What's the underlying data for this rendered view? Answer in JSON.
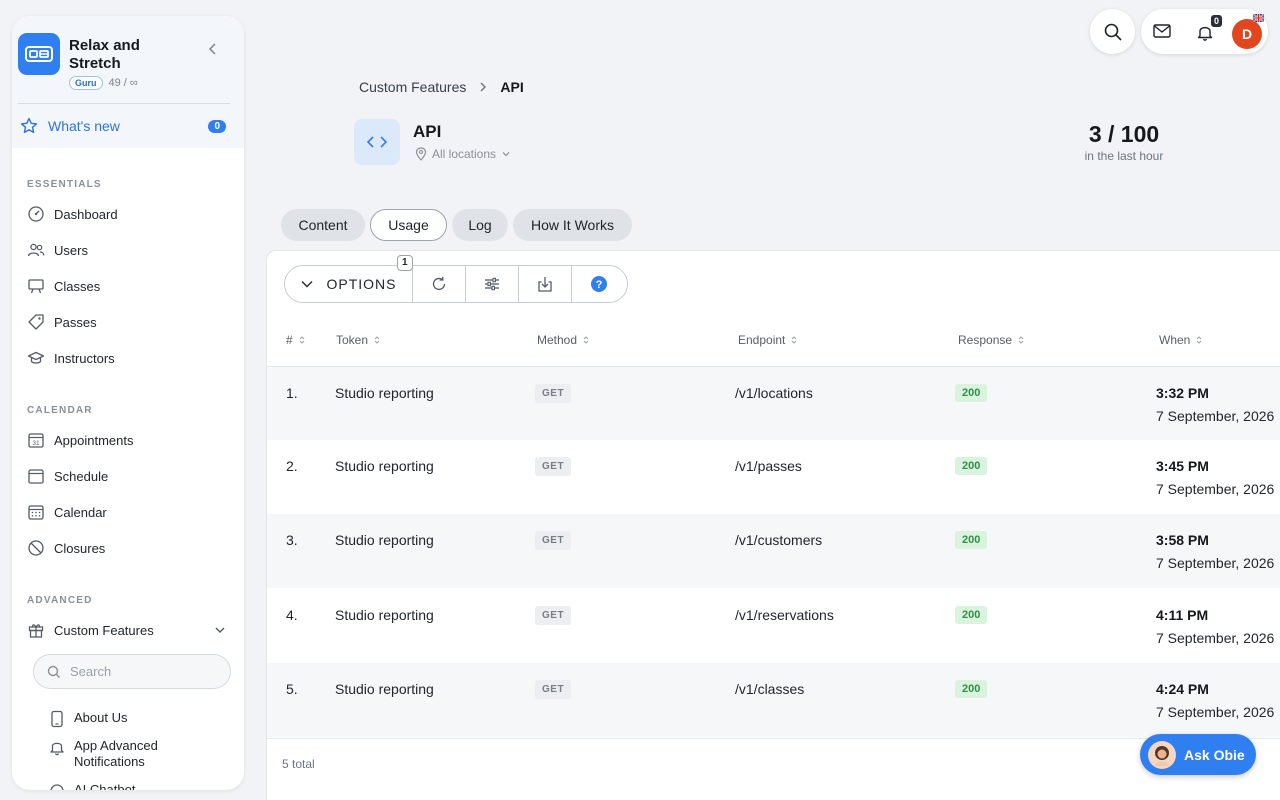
{
  "app": {
    "name": "Relax and Stretch",
    "plan_badge": "Guru",
    "usage": "49 / ∞"
  },
  "sidebar": {
    "whats_new": {
      "label": "What's new",
      "count": "0"
    },
    "sections": [
      {
        "title": "ESSENTIALS",
        "items": [
          {
            "label": "Dashboard",
            "icon": "gauge-icon"
          },
          {
            "label": "Users",
            "icon": "users-icon"
          },
          {
            "label": "Classes",
            "icon": "easel-icon"
          },
          {
            "label": "Passes",
            "icon": "ticket-icon"
          },
          {
            "label": "Instructors",
            "icon": "graduation-cap-icon"
          }
        ]
      },
      {
        "title": "CALENDAR",
        "items": [
          {
            "label": "Appointments",
            "icon": "calendar-31-icon"
          },
          {
            "label": "Schedule",
            "icon": "calendar-icon"
          },
          {
            "label": "Calendar",
            "icon": "calendar-grid-icon"
          },
          {
            "label": "Closures",
            "icon": "ban-icon"
          }
        ]
      },
      {
        "title": "ADVANCED",
        "items": [
          {
            "label": "Custom Features",
            "icon": "gift-icon"
          }
        ]
      }
    ],
    "search_placeholder": "Search",
    "sub_items": [
      {
        "label": "About Us",
        "icon": "phone-icon"
      },
      {
        "label": "App Advanced Notifications",
        "icon": "bell-icon"
      },
      {
        "label": "AI Chatbot",
        "icon": "chat-icon"
      }
    ]
  },
  "topbar": {
    "notifications_count": "0",
    "avatar_initial": "D"
  },
  "breadcrumb": {
    "parent": "Custom Features",
    "current": "API"
  },
  "page": {
    "title": "API",
    "location": "All locations",
    "quota_value": "3 / 100",
    "quota_caption": "in the last hour"
  },
  "tabs": [
    "Content",
    "Usage",
    "Log",
    "How It Works"
  ],
  "active_tab": "Usage",
  "toolbar": {
    "options_label": "OPTIONS",
    "options_badge": "1"
  },
  "table": {
    "columns": [
      "#",
      "Token",
      "Method",
      "Endpoint",
      "Response",
      "When"
    ],
    "rows": [
      {
        "num": "1.",
        "token": "Studio reporting",
        "method": "GET",
        "endpoint": "/v1/locations",
        "response": "200",
        "time": "3:32 PM",
        "date": "7 September, 2026"
      },
      {
        "num": "2.",
        "token": "Studio reporting",
        "method": "GET",
        "endpoint": "/v1/passes",
        "response": "200",
        "time": "3:45 PM",
        "date": "7 September, 2026"
      },
      {
        "num": "3.",
        "token": "Studio reporting",
        "method": "GET",
        "endpoint": "/v1/customers",
        "response": "200",
        "time": "3:58 PM",
        "date": "7 September, 2026"
      },
      {
        "num": "4.",
        "token": "Studio reporting",
        "method": "GET",
        "endpoint": "/v1/reservations",
        "response": "200",
        "time": "4:11 PM",
        "date": "7 September, 2026"
      },
      {
        "num": "5.",
        "token": "Studio reporting",
        "method": "GET",
        "endpoint": "/v1/classes",
        "response": "200",
        "time": "4:24 PM",
        "date": "7 September, 2026"
      }
    ],
    "total": "5 total"
  },
  "assistant": {
    "label": "Ask Obie"
  },
  "colors": {
    "accent": "#2f7ff0",
    "success_bg": "#d9f3df",
    "success_text": "#2e9143",
    "avatar": "#e2461f"
  }
}
